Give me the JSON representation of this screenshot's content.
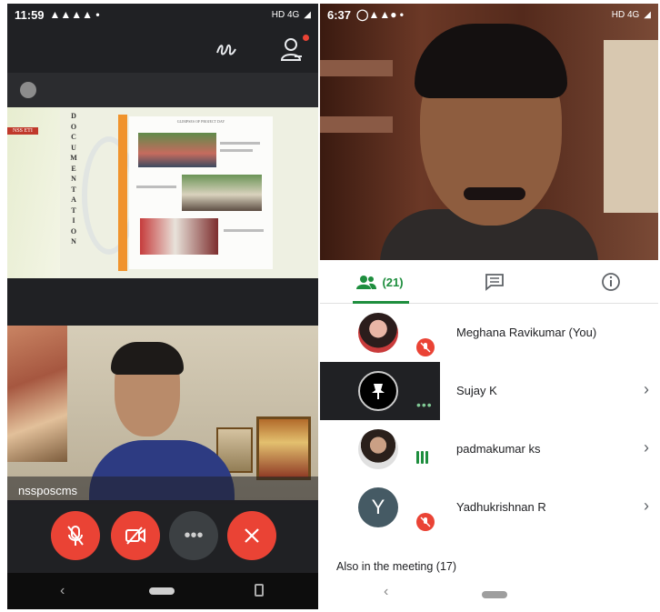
{
  "left_phone": {
    "status": {
      "time": "11:59",
      "right": "HD 4G"
    },
    "video_tile_name": "nssposcms",
    "slide": {
      "badge": "NSS ETI",
      "vertical_title": [
        "D",
        "O",
        "C",
        "U",
        "M",
        "E",
        "N",
        "T",
        "A",
        "T",
        "I",
        "O",
        "N"
      ],
      "photo_header": "GLIMPSES OF PROJECT DAY"
    },
    "controls": {
      "more_label": "•••"
    },
    "colors": {
      "end_call": "#ea4335",
      "toolbar": "#202124"
    }
  },
  "right_phone": {
    "status": {
      "time": "6:37",
      "right": "HD 4G"
    },
    "tabs": {
      "people_count": "(21)"
    },
    "participants": [
      {
        "name": "Meghana Ravikumar (You)",
        "avatar": "photo",
        "state": "muted"
      },
      {
        "name": "Sujay K",
        "avatar": "pinned",
        "state": "speaking-dots"
      },
      {
        "name": "padmakumar ks",
        "avatar": "photo",
        "state": "speaking-bars"
      },
      {
        "name": "Yadhukrishnan R",
        "avatar": "letter",
        "initial": "Y",
        "state": "muted"
      }
    ],
    "also_in_meeting": "Also in the meeting (17)",
    "colors": {
      "accent": "#1e8e3e",
      "muted": "#ea4335"
    }
  }
}
